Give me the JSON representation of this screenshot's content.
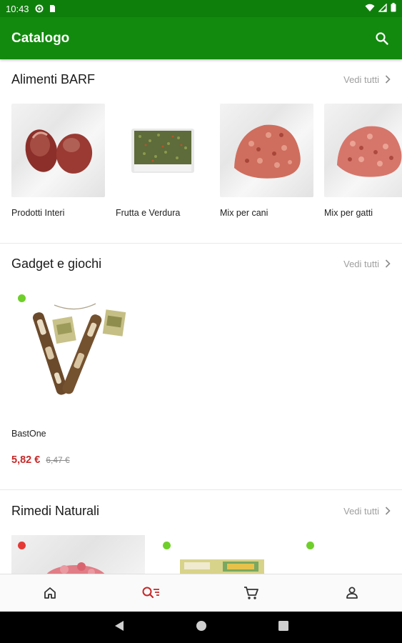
{
  "status_bar": {
    "time": "10:43",
    "icons": [
      "data-saver-icon",
      "sd-card-icon",
      "wifi-icon",
      "signal-icon",
      "battery-icon"
    ]
  },
  "app_bar": {
    "title": "Catalogo",
    "search_icon": "search-icon"
  },
  "sections": [
    {
      "title": "Alimenti BARF",
      "see_all": "Vedi tutti",
      "items": [
        {
          "label": "Prodotti Interi",
          "image": "raw-meat-hearts"
        },
        {
          "label": "Frutta e Verdura",
          "image": "vegetable-tray"
        },
        {
          "label": "Mix per cani",
          "image": "ground-meat-mix"
        },
        {
          "label": "Mix per gatti",
          "image": "ground-meat-mix"
        }
      ]
    },
    {
      "title": "Gadget e giochi",
      "see_all": "Vedi tutti",
      "products": [
        {
          "name": "BastOne",
          "price": "5,82 €",
          "old_price": "6,47 €",
          "availability": "green",
          "image": "chew-sticks"
        }
      ]
    },
    {
      "title": "Rimedi Naturali",
      "see_all": "Vedi tutti",
      "products": [
        {
          "availability": "red",
          "image": "meat-pieces"
        },
        {
          "availability": "green",
          "image": "supplement-box"
        },
        {
          "availability": "green",
          "image": "blank"
        }
      ]
    }
  ],
  "bottom_nav": {
    "items": [
      {
        "icon": "home-icon",
        "active": false
      },
      {
        "icon": "catalog-search-icon",
        "active": true
      },
      {
        "icon": "cart-icon",
        "active": false
      },
      {
        "icon": "account-icon",
        "active": false
      }
    ]
  },
  "system_nav": [
    "back-icon",
    "home-circle-icon",
    "recents-icon"
  ],
  "colors": {
    "primary": "#128a0e",
    "status_bar": "#0f7f0c",
    "price": "#c62828",
    "dot_green": "#6fcf2a",
    "dot_red": "#e53935",
    "active_nav": "#c62828"
  }
}
